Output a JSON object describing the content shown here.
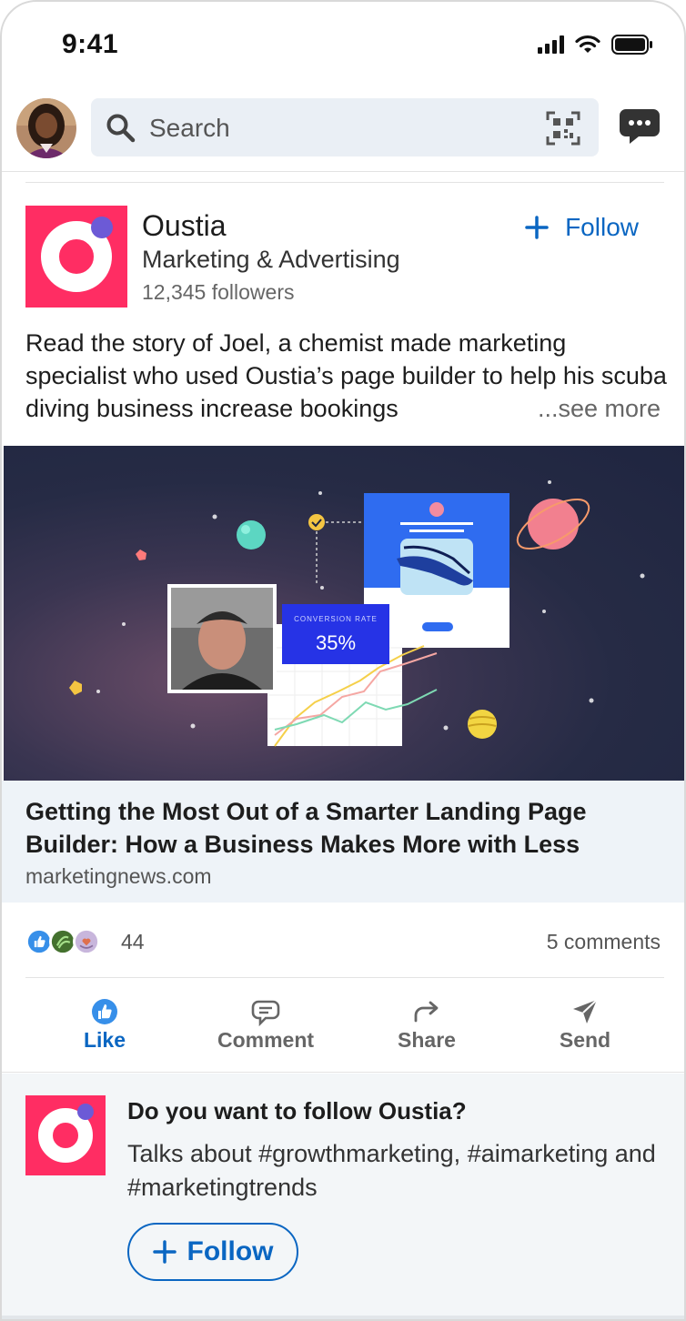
{
  "status_bar": {
    "time": "9:41"
  },
  "search": {
    "placeholder": "Search"
  },
  "post": {
    "company_name": "Oustia",
    "industry": "Marketing & Advertising",
    "followers": "12,345 followers",
    "follow_label": "Follow",
    "text": "Read the story of Joel, a chemist made marketing specialist who used Oustia’s page builder to help his scuba diving business increase bookings",
    "see_more": "...see more",
    "image": {
      "conversion_label": "CONVERSION RATE",
      "conversion_value": "35%"
    },
    "link": {
      "title": "Getting the Most Out of a Smarter Landing Page Builder: How a Business Makes More with Less",
      "domain": "marketingnews.com"
    },
    "reaction_count": "44",
    "comments": "5 comments",
    "actions": [
      {
        "label": "Like",
        "icon": "like-icon"
      },
      {
        "label": "Comment",
        "icon": "comment-icon"
      },
      {
        "label": "Share",
        "icon": "share-icon"
      },
      {
        "label": "Send",
        "icon": "send-icon"
      }
    ]
  },
  "suggestion": {
    "title": "Do you want to follow Oustia?",
    "description": "Talks about #growthmarketing, #aimarketing and #marketingtrends",
    "button_label": "Follow"
  },
  "colors": {
    "brand_pink": "#ff2d63",
    "brand_purple": "#6c5ad6",
    "link_blue": "#0a66c2",
    "search_bg": "#eaeff5"
  }
}
